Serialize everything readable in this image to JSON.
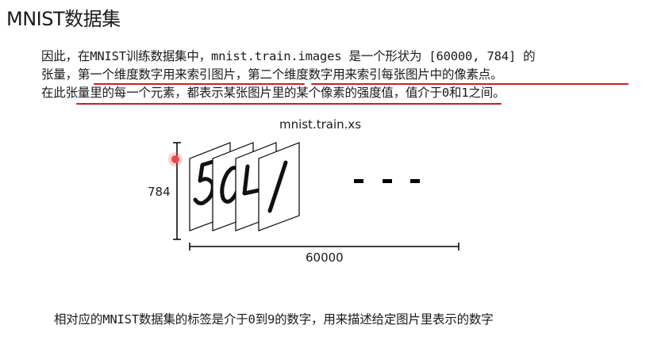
{
  "title": "MNIST数据集",
  "paragraph": {
    "line1": "因此，在MNIST训练数据集中，mnist.train.images 是一个形状为 [60000, 784] 的",
    "line2": "张量，第一个维度数字用来索引图片，第二个维度数字用来索引每张图片中的像素点。",
    "line3": "在此张量里的每一个元素，都表示某张图片里的某个像素的强度值，值介于0和1之间。"
  },
  "figure": {
    "title": "mnist.train.xs",
    "dim_vertical": "784",
    "dim_horizontal": "60000",
    "ellipsis": "- - -",
    "digits": [
      "5",
      "0",
      "4",
      "1"
    ]
  },
  "footer": "相对应的MNIST数据集的标签是介于0到9的数字，用来描述给定图片里表示的数字",
  "colors": {
    "underline": "#c8202a",
    "cursor": "#e84a4a"
  }
}
